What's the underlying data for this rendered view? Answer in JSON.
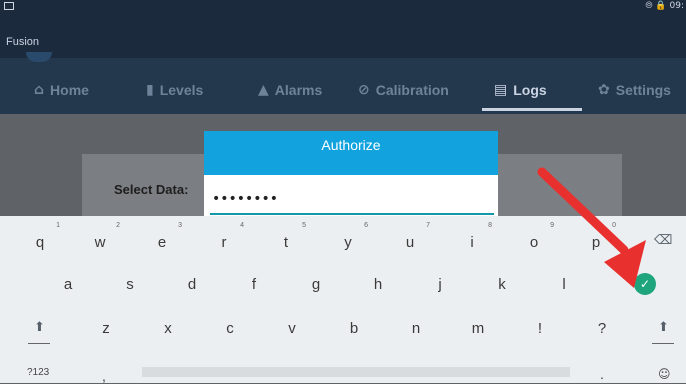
{
  "status_bar": {
    "right_text": "⦾ 🔒 09:"
  },
  "app": {
    "title": "Fusion"
  },
  "nav": {
    "items": [
      {
        "label": "Home",
        "icon": "⌂"
      },
      {
        "label": "Levels",
        "icon": "▮"
      },
      {
        "label": "Alarms",
        "icon": "▲"
      },
      {
        "label": "Calibration",
        "icon": "⊘"
      },
      {
        "label": "Logs",
        "icon": "▤"
      },
      {
        "label": "Settings",
        "icon": "✿"
      }
    ],
    "active": "Logs"
  },
  "content": {
    "select_label": "Select Data:"
  },
  "dialog": {
    "title": "Authorize",
    "password_value": "••••••••"
  },
  "keyboard": {
    "row1": [
      "q",
      "w",
      "e",
      "r",
      "t",
      "y",
      "u",
      "i",
      "o",
      "p"
    ],
    "row1_hints": [
      "1",
      "2",
      "3",
      "4",
      "5",
      "6",
      "7",
      "8",
      "9",
      "0"
    ],
    "row2": [
      "a",
      "s",
      "d",
      "f",
      "g",
      "h",
      "j",
      "k",
      "l"
    ],
    "row3": [
      "z",
      "x",
      "c",
      "v",
      "b",
      "n",
      "m",
      "!",
      "?"
    ],
    "backspace_icon": "⌫",
    "enter_icon": "✓",
    "shift_icon": "⬆",
    "symbols_label": "?123",
    "comma": ",",
    "period": ".",
    "emoji_icon": "☺"
  },
  "annotation": {
    "arrow_color": "#e8312f"
  }
}
